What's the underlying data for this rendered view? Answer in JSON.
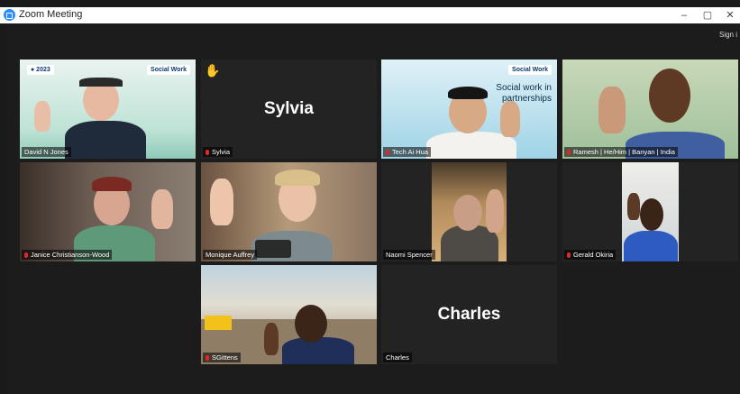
{
  "window": {
    "title": "Zoom Meeting",
    "minimize": "–",
    "restore": "▢",
    "close": "✕"
  },
  "toolbar": {
    "sign_in": "Sign i"
  },
  "participants": [
    {
      "name": "David N Jones",
      "display": "",
      "badge": "Social Work",
      "muted": false,
      "active": true
    },
    {
      "name": "Sylvia",
      "display": "Sylvia",
      "muted": true,
      "hand_raised": true
    },
    {
      "name": "Tech Ai Hua",
      "display": "",
      "badge": "Social Work",
      "overlay": "Social work in partnerships",
      "muted": true
    },
    {
      "name": "Ramesh | He/Him | Banyan | India",
      "display": "",
      "muted": true
    },
    {
      "name": "Janice Christianson-Wood",
      "display": "",
      "muted": true
    },
    {
      "name": "Monique Auffrey",
      "display": "",
      "muted": false
    },
    {
      "name": "Naomi Spencer",
      "display": "",
      "muted": false
    },
    {
      "name": "Gerald Okiria",
      "display": "",
      "muted": true
    },
    {
      "name": "SGittens",
      "display": "",
      "muted": true
    },
    {
      "name": "Charles",
      "display": "Charles",
      "muted": false
    }
  ],
  "colors": {
    "active_border": "#d6e16a",
    "accent": "#2d8cff",
    "mic_muted": "#e02828"
  }
}
